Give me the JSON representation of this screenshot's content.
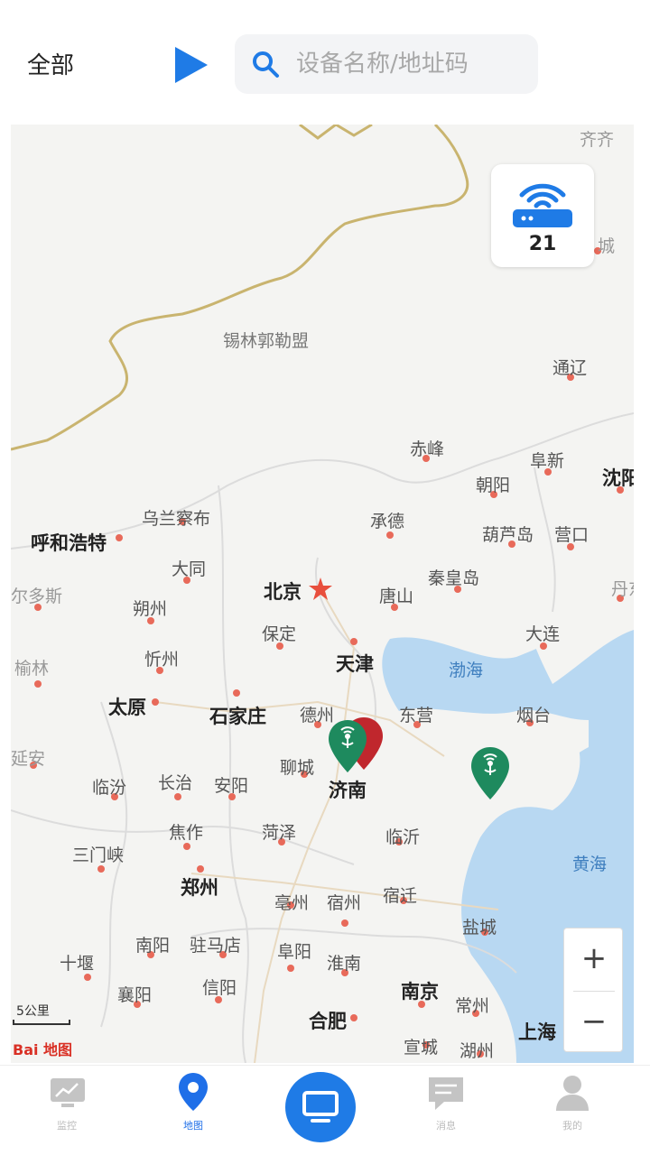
{
  "header": {
    "filter_label": "全部",
    "search_placeholder": "设备名称/地址码"
  },
  "device_card": {
    "count": "21",
    "icon": "router-icon"
  },
  "map": {
    "regions": [
      "锡林郭勒盟"
    ],
    "seas": [
      "渤海",
      "黄海"
    ],
    "cities": {
      "beijing": "北京",
      "tianjin": "天津",
      "shijiazhuang": "石家庄",
      "taiyuan": "太原",
      "jinan": "济南",
      "zhengzhou": "郑州",
      "hefei": "合肥",
      "nanjing": "南京",
      "shanghai": "上海",
      "shenyang": "沈阳",
      "huhehaote": "呼和浩特",
      "chifeng": "赤峰",
      "tongliao": "通辽",
      "fuxin": "阜新",
      "chaoyang": "朝阳",
      "chengde": "承德",
      "huludao": "葫芦岛",
      "yingkou": "营口",
      "qinhuangdao": "秦皇岛",
      "tangshan": "唐山",
      "dalian": "大连",
      "wulanchabu": "乌兰察布",
      "datong": "大同",
      "shuozhou": "朔州",
      "xinzhou": "忻州",
      "baoding": "保定",
      "dezhou": "德州",
      "dongying": "东营",
      "yantai": "烟台",
      "liaocheng": "聊城",
      "linfen": "临汾",
      "changzhi": "长治",
      "anyang": "安阳",
      "heze": "菏泽",
      "linyi": "临沂",
      "jiaozuo": "焦作",
      "sanmenxia": "三门峡",
      "bozhou": "亳州",
      "suzhou_ah": "宿州",
      "suqian": "宿迁",
      "yancheng": "盐城",
      "nanyang": "南阳",
      "zhumadian": "驻马店",
      "fuyang": "阜阳",
      "huainan": "淮南",
      "shiyan": "十堰",
      "xiangyang": "襄阳",
      "xinyang": "信阳",
      "changzhou": "常州",
      "xuancheng": "宣城",
      "huzhou": "湖州",
      "yulin": "榆林",
      "yanan": "延安",
      "eerduosi": "尔多斯",
      "qiqihaer": "齐齐",
      "dandong": "丹东",
      "cheng": "城"
    },
    "scale_label": "5公里",
    "baidu_logo": "Bai 地图",
    "markers": [
      {
        "name": "jinan-station",
        "color": "#1e8a5e"
      },
      {
        "name": "jinan-station-alert",
        "color": "#c0272d"
      },
      {
        "name": "qingdao-station",
        "color": "#1e8a5e"
      }
    ]
  },
  "zoom": {
    "plus": "+",
    "minus": "−"
  },
  "tabbar": {
    "tabs": [
      {
        "label": "监控",
        "icon": "monitor-chart-icon",
        "active": false
      },
      {
        "label": "地图",
        "icon": "map-pin-icon",
        "active": true
      },
      {
        "label": "",
        "icon": "screen-icon",
        "active": false
      },
      {
        "label": "消息",
        "icon": "message-icon",
        "active": false
      },
      {
        "label": "我的",
        "icon": "user-icon",
        "active": false
      }
    ]
  },
  "colors": {
    "accent": "#1f7be6",
    "marker_green": "#1e8a5e",
    "marker_red": "#c0272d",
    "sea": "#b8d8f2",
    "border": "#c9b46f"
  }
}
